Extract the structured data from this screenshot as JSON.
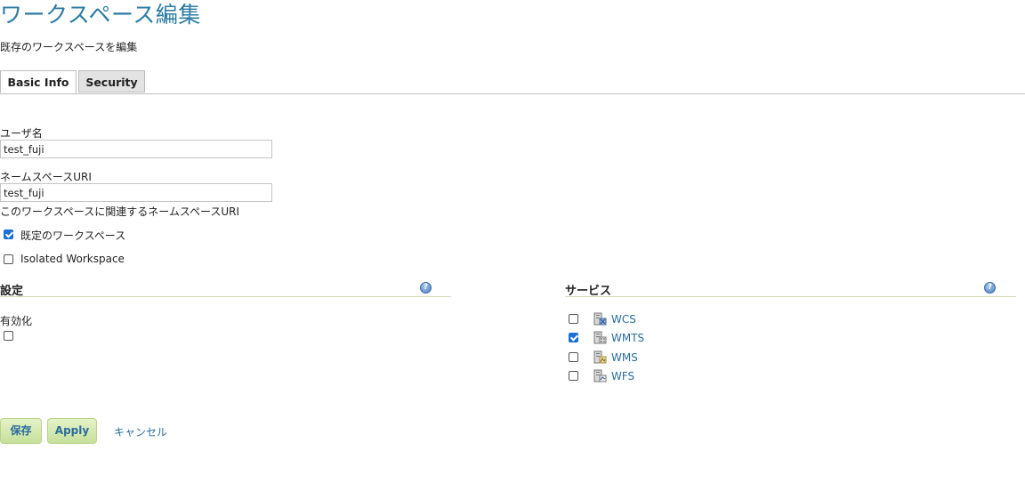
{
  "page": {
    "title": "ワークスペース編集",
    "subtitle": "既存のワークスペースを編集"
  },
  "tabs": [
    {
      "label": "Basic Info",
      "active": true
    },
    {
      "label": "Security",
      "active": false
    }
  ],
  "form": {
    "name_label": "ユーザ名",
    "name_value": "test_fuji",
    "uri_label": "ネームスペースURI",
    "uri_value": "test_fuji",
    "uri_hint": "このワークスペースに関連するネームスペースURI",
    "default_workspace_label": "既定のワークスペース",
    "default_workspace_checked": true,
    "isolated_label": "Isolated Workspace",
    "isolated_checked": false
  },
  "settings": {
    "title": "設定",
    "help_icon": "help-icon",
    "enabled_label": "有効化",
    "enabled_checked": false
  },
  "services": {
    "title": "サービス",
    "help_icon": "help-icon",
    "items": [
      {
        "label": "WCS",
        "checked": false,
        "icon": "wcs-service-icon"
      },
      {
        "label": "WMTS",
        "checked": true,
        "icon": "wmts-service-icon"
      },
      {
        "label": "WMS",
        "checked": false,
        "icon": "wms-service-icon"
      },
      {
        "label": "WFS",
        "checked": false,
        "icon": "wfs-service-icon"
      }
    ]
  },
  "buttons": {
    "save_label": "保存",
    "apply_label": "Apply",
    "cancel_label": "キャンセル"
  },
  "colors": {
    "title": "#2b7ba5",
    "link": "#2b6c9e",
    "button_bg": "#d4e9b0",
    "checkbox_checked": "#1a6fd8"
  }
}
